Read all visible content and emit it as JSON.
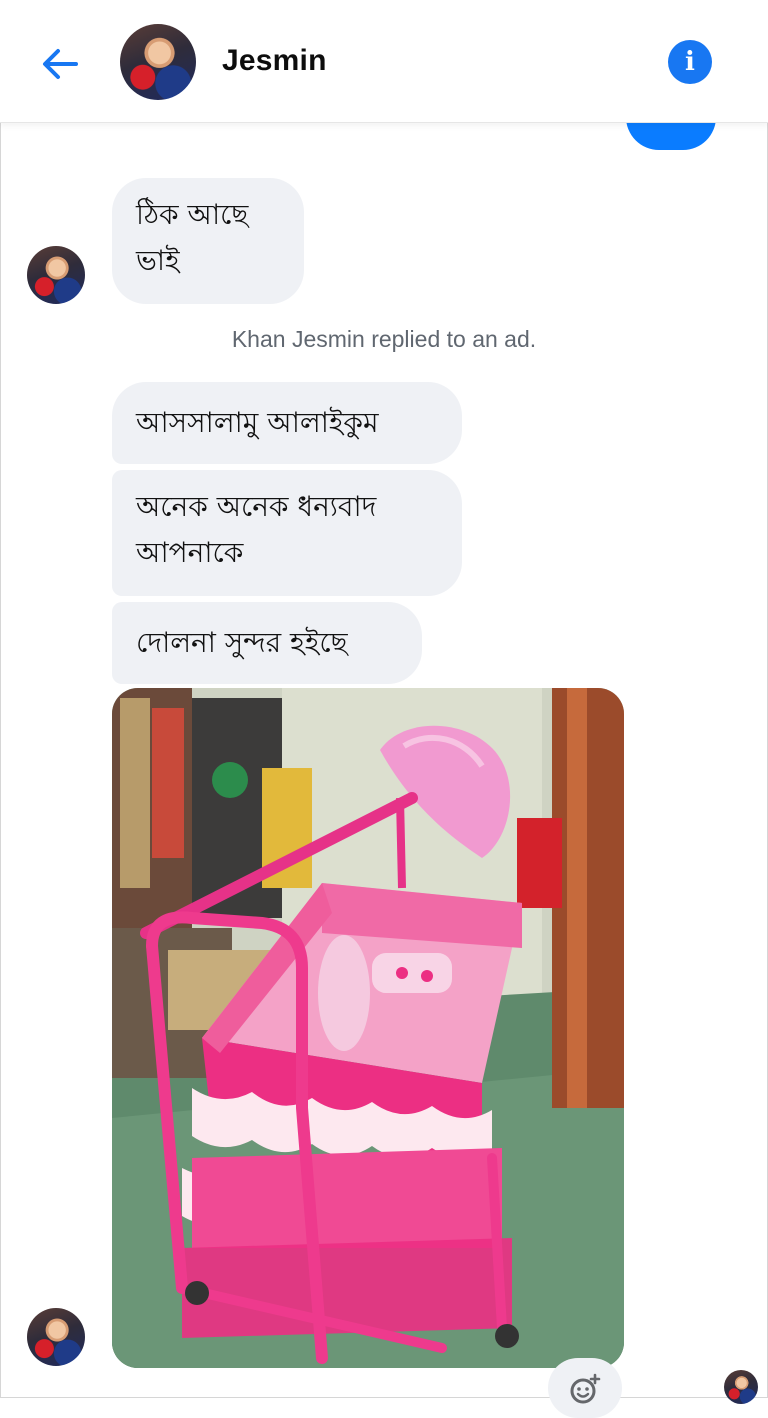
{
  "header": {
    "contact_name": "Jesmin",
    "back_icon": "arrow-left-icon",
    "info_icon": "info-icon",
    "accent_color": "#1877f2"
  },
  "messages": [
    {
      "type": "text",
      "lines": [
        "ঠিক আছে",
        "ভাই"
      ]
    },
    {
      "type": "system",
      "text": "Khan Jesmin replied to an ad."
    },
    {
      "type": "text",
      "lines": [
        "আসসালামু আলাইকুম"
      ]
    },
    {
      "type": "text",
      "lines": [
        "অনেক অনেক ধন্যবাদ",
        "আপনাকে"
      ]
    },
    {
      "type": "text",
      "lines": [
        "দোলনা সুন্দর হইছে"
      ]
    },
    {
      "type": "image",
      "subject": "pink-baby-cradle"
    }
  ],
  "reaction_icon": "add-reaction-icon",
  "colors": {
    "incoming_bubble": "#eff1f5",
    "outgoing_bubble": "#0a7cff",
    "cradle_pink": "#ec2f83"
  }
}
